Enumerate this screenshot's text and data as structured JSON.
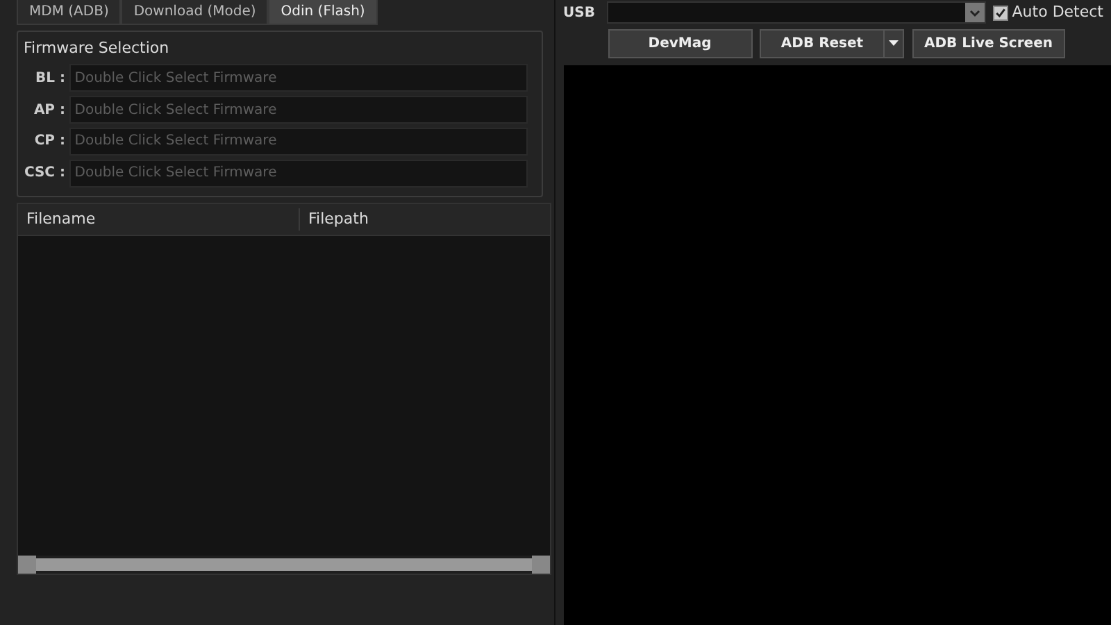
{
  "tabs": [
    {
      "label": "MDM (ADB)",
      "selected": false
    },
    {
      "label": "Download (Mode)",
      "selected": false
    },
    {
      "label": "Odin (Flash)",
      "selected": true
    }
  ],
  "firmware_selection": {
    "title": "Firmware Selection",
    "fields": [
      {
        "label": "BL :",
        "placeholder": "Double Click Select Firmware"
      },
      {
        "label": "AP :",
        "placeholder": "Double Click Select Firmware"
      },
      {
        "label": "CP :",
        "placeholder": "Double Click Select Firmware"
      },
      {
        "label": "CSC :",
        "placeholder": "Double Click Select Firmware"
      }
    ]
  },
  "file_table": {
    "columns": [
      "Filename",
      "Filepath"
    ]
  },
  "device": {
    "port_label": "USB",
    "auto_detect": {
      "label": "Auto Detect",
      "checked": true
    }
  },
  "buttons": [
    {
      "label": "DevMag",
      "kind": "plain"
    },
    {
      "label": "ADB Reset",
      "kind": "split"
    },
    {
      "label": "ADB Live Screen",
      "kind": "plain"
    }
  ]
}
